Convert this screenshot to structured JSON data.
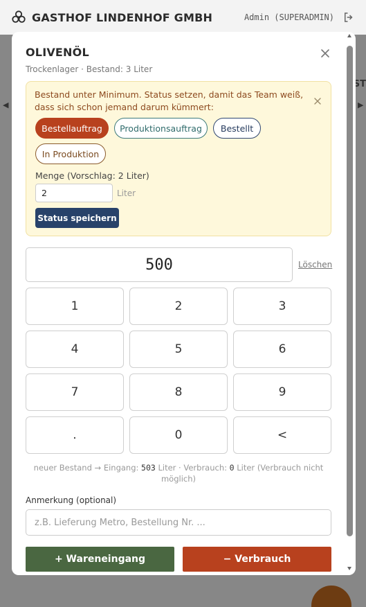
{
  "header": {
    "brand_name": "GASTHOF LINDENHOF GMBH",
    "user_info": "Admin (SUPERADMIN)",
    "brand_icon": "clover-icon",
    "logout_icon": "logout-icon"
  },
  "background": {
    "edge_text": "ST"
  },
  "modal": {
    "title": "OLIVENÖL",
    "subtitle": "Trockenlager · Bestand: 3 Liter",
    "alert": {
      "text": "Bestand unter Minimum. Status setzen, damit das Team weiß, dass sich schon jemand darum kümmert:",
      "status_options": [
        "Bestellauftrag",
        "Produktionsauftrag",
        "Bestellt",
        "In Produktion"
      ],
      "selected_status": "Bestellauftrag",
      "quantity_label": "Menge (Vorschlag: 2 Liter)",
      "quantity_value": "2",
      "quantity_unit": "Liter",
      "save_label": "Status speichern"
    },
    "display_value": "500",
    "clear_label": "Löschen",
    "keypad": [
      "1",
      "2",
      "3",
      "4",
      "5",
      "6",
      "7",
      "8",
      "9",
      ".",
      "0",
      "<"
    ],
    "summary": {
      "prefix": "neuer Bestand → Eingang: ",
      "in_value": "503",
      "mid": " Liter · Verbrauch: ",
      "out_value": "0",
      "suffix": " Liter (Verbrauch nicht möglich)"
    },
    "note_label": "Anmerkung (optional)",
    "note_placeholder": "z.B. Lieferung Metro, Bestellung Nr. ...",
    "btn_in_label": "+ Wareneingang",
    "btn_out_label": "− Verbrauch"
  },
  "colors": {
    "primary_red": "#b8411e",
    "primary_green": "#4a6741",
    "navy": "#28426a",
    "alert_bg": "#fef8db"
  }
}
